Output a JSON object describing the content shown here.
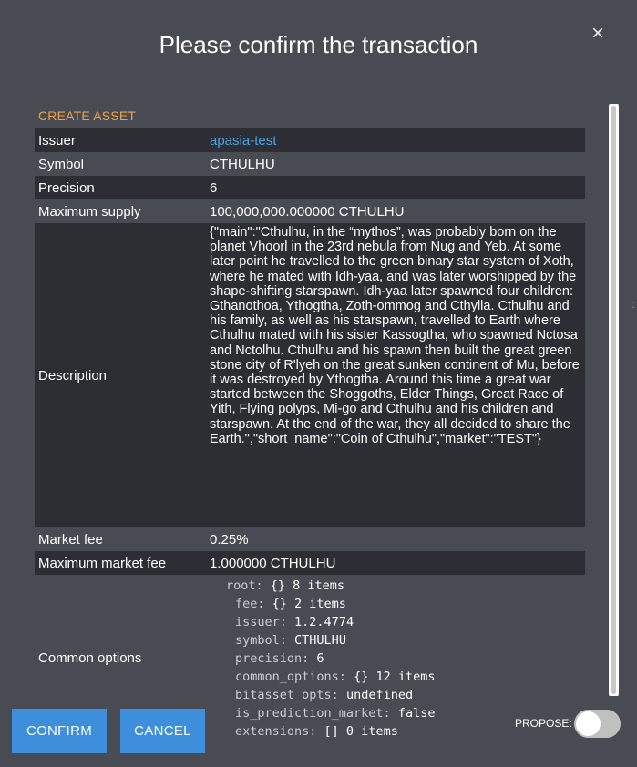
{
  "modal": {
    "title": "Please confirm the transaction",
    "close_icon": "×"
  },
  "operation": {
    "title": "CREATE ASSET",
    "rows": {
      "issuer": {
        "label": "Issuer",
        "value": "apasia-test"
      },
      "symbol": {
        "label": "Symbol",
        "value": "CTHULHU"
      },
      "precision": {
        "label": "Precision",
        "value": "6"
      },
      "max_supply": {
        "label": "Maximum supply",
        "value": "100,000,000.000000 CTHULHU"
      },
      "description": {
        "label": "Description",
        "value": "{\"main\":\"Cthulhu, in the “mythos”, was probably born on the planet Vhoorl in the 23rd nebula from Nug and Yeb. At some later point he travelled to the green binary star system of Xoth, where he mated with Idh-yaa, and was later worshipped by the shape-shifting starspawn. Idh-yaa later spawned four children: Gthanothoa, Ythogtha, Zoth-ommog and Cthylla. Cthulhu and his family, as well as his starspawn, travelled to Earth where Cthulhu mated with his sister Kassogtha, who spawned Nctosa and Nctolhu. Cthulhu and his spawn then built the great green stone city of R'lyeh on the great sunken continent of Mu, before it was destroyed by Ythogtha. Around this time a great war started between the Shoggoths, Elder Things, Great Race of Yith, Flying polyps, Mi-go and Cthulhu and his children and starspawn. At the end of the war, they all decided to share the Earth.\",\"short_name\":\"Coin of Cthulhu\",\"market\":\"TEST\"}"
      },
      "market_fee": {
        "label": "Market fee",
        "value": "0.25%"
      },
      "max_market_fee": {
        "label": "Maximum market fee",
        "value": "1.000000 CTHULHU"
      },
      "common_options": {
        "label": "Common options",
        "tree": [
          {
            "key": "root:",
            "val": "{} 8 items"
          },
          {
            "key": "fee:",
            "val": "{} 2 items"
          },
          {
            "key": "issuer:",
            "val": "1.2.4774"
          },
          {
            "key": "symbol:",
            "val": "CTHULHU"
          },
          {
            "key": "precision:",
            "val": "6"
          },
          {
            "key": "common_options:",
            "val": "{} 12 items"
          },
          {
            "key": "bitasset_opts:",
            "val": "undefined"
          },
          {
            "key": "is_prediction_market:",
            "val": "false"
          },
          {
            "key": "extensions:",
            "val": "[] 0 items"
          }
        ]
      }
    }
  },
  "footer": {
    "confirm_label": "CONFIRM",
    "cancel_label": "CANCEL",
    "propose_label": "PROPOSE:",
    "propose_on": false
  },
  "edge_glyph": ":",
  "colors": {
    "modal_bg": "#484b51",
    "row_dark": "#2c2e33",
    "accent_orange": "#f0a04a",
    "link_blue": "#4aa3e4",
    "button_blue": "#3d8fdc"
  }
}
